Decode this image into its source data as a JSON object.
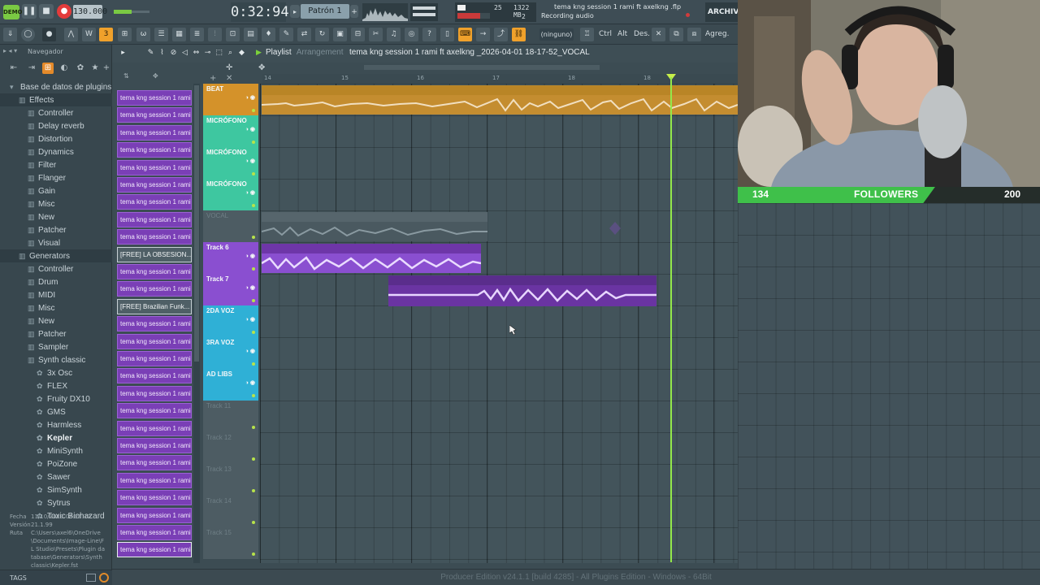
{
  "transport": {
    "logo_text": "DEMO",
    "bpm": "130.000",
    "time": "0:32:94",
    "pattern": "Patrón 1",
    "cpu_value": "25",
    "ram_value": "1322 MB",
    "poly_value": "2"
  },
  "hint_bar": {
    "file": "tema kng session 1 rami ft axelkng .flp",
    "status": "Recording audio"
  },
  "menu_label": "ARCHIVO (",
  "toolbar": {
    "ninguno": "(ninguno)",
    "ctrl": "Ctrl",
    "alt": "Alt",
    "des": "Des.",
    "agreg": "Agreg."
  },
  "browser": {
    "nav_title": "Navegador",
    "items": [
      {
        "label": "Base de datos de plugins",
        "indent": 0,
        "bold": false
      },
      {
        "label": "Effects",
        "indent": 1,
        "bold": false
      },
      {
        "label": "Controller",
        "indent": 2,
        "bold": false
      },
      {
        "label": "Delay reverb",
        "indent": 2,
        "bold": false
      },
      {
        "label": "Distortion",
        "indent": 2,
        "bold": false
      },
      {
        "label": "Dynamics",
        "indent": 2,
        "bold": false
      },
      {
        "label": "Filter",
        "indent": 2,
        "bold": false
      },
      {
        "label": "Flanger",
        "indent": 2,
        "bold": false
      },
      {
        "label": "Gain",
        "indent": 2,
        "bold": false
      },
      {
        "label": "Misc",
        "indent": 2,
        "bold": false
      },
      {
        "label": "New",
        "indent": 2,
        "bold": false
      },
      {
        "label": "Patcher",
        "indent": 2,
        "bold": false
      },
      {
        "label": "Visual",
        "indent": 2,
        "bold": false
      },
      {
        "label": "Generators",
        "indent": 1,
        "bold": false
      },
      {
        "label": "Controller",
        "indent": 2,
        "bold": false
      },
      {
        "label": "Drum",
        "indent": 2,
        "bold": false
      },
      {
        "label": "MIDI",
        "indent": 2,
        "bold": false
      },
      {
        "label": "Misc",
        "indent": 2,
        "bold": false
      },
      {
        "label": "New",
        "indent": 2,
        "bold": false
      },
      {
        "label": "Patcher",
        "indent": 2,
        "bold": false
      },
      {
        "label": "Sampler",
        "indent": 2,
        "bold": false
      },
      {
        "label": "Synth classic",
        "indent": 2,
        "bold": false
      },
      {
        "label": "3x Osc",
        "indent": 3,
        "bold": false
      },
      {
        "label": "FLEX",
        "indent": 3,
        "bold": false
      },
      {
        "label": "Fruity DX10",
        "indent": 3,
        "bold": false
      },
      {
        "label": "GMS",
        "indent": 3,
        "bold": false
      },
      {
        "label": "Harmless",
        "indent": 3,
        "bold": false
      },
      {
        "label": "Kepler",
        "indent": 3,
        "bold": true
      },
      {
        "label": "MiniSynth",
        "indent": 3,
        "bold": false
      },
      {
        "label": "PoiZone",
        "indent": 3,
        "bold": false
      },
      {
        "label": "Sawer",
        "indent": 3,
        "bold": false
      },
      {
        "label": "SimSynth",
        "indent": 3,
        "bold": false
      },
      {
        "label": "Sytrus",
        "indent": 3,
        "bold": false
      },
      {
        "label": "Toxic Biohazard",
        "indent": 3,
        "bold": false
      }
    ],
    "meta": {
      "fecha_label": "Fecha",
      "fecha": "11/10/2023 08:21:12",
      "version_label": "Versión",
      "version": "21.1.99",
      "ruta_label": "Ruta",
      "ruta": "C:\\Users\\axel6\\OneDrive\\Documents\\Image-Line\\FL Studio\\Presets\\Plugin database\\Generators\\Synth classic\\Kepler.fst"
    },
    "tags": "TAGS"
  },
  "playlist": {
    "title": "Playlist",
    "subtitle": "Arrangement",
    "file": "tema kng session 1 rami ft axelkng _2026-04-01 18-17-52_VOCAL",
    "ruler": [
      "14",
      "15",
      "16",
      "17",
      "18",
      "18"
    ],
    "patterns": [
      "tema kng session 1 rami...",
      "tema kng session 1 rami...",
      "tema kng session 1 rami...",
      "tema kng session 1 rami...",
      "tema kng session 1 rami...",
      "tema kng session 1 rami...",
      "tema kng session 1 rami...",
      "tema kng session 1 rami...",
      "tema kng session 1 rami...",
      "[FREE] LA OBSESION...",
      "tema kng session 1 rami...",
      "tema kng session 1 rami...",
      "[FREE] Brazilian Funk...",
      "tema kng session 1 rami...",
      "tema kng session 1 rami...",
      "tema kng session 1 rami...",
      "tema kng session 1 rami...",
      "tema kng session 1 rami...",
      "tema kng session 1 rami...",
      "tema kng session 1 rami...",
      "tema kng session 1 rami...",
      "tema kng session 1 rami...",
      "tema kng session 1 rami...",
      "tema kng session 1 rami...",
      "tema kng session 1 rami...",
      "tema kng session 1 rami...",
      "tema kng session 1 rami..."
    ],
    "tracks": [
      {
        "name": "BEAT",
        "color": "#d4922a"
      },
      {
        "name": "MICRÓFONO",
        "color": "#3ec7a0"
      },
      {
        "name": "MICRÓFONO",
        "color": "#3ec7a0"
      },
      {
        "name": "MICRÓFONO",
        "color": "#3ec7a0"
      },
      {
        "name": "VOCAL",
        "color": "#4d5c63"
      },
      {
        "name": "Track 6",
        "color": "#8a4fd0"
      },
      {
        "name": "Track 7",
        "color": "#8a4fd0"
      },
      {
        "name": "2DA VOZ",
        "color": "#2fb0d6"
      },
      {
        "name": "3RA VOZ",
        "color": "#2fb0d6"
      },
      {
        "name": "AD LIBS",
        "color": "#2fb0d6"
      },
      {
        "name": "Track 11",
        "color": "#4d5c63"
      },
      {
        "name": "Track 12",
        "color": "#4d5c63"
      },
      {
        "name": "Track 13",
        "color": "#4d5c63"
      },
      {
        "name": "Track 14",
        "color": "#4d5c63"
      },
      {
        "name": "Track 15",
        "color": "#4d5c63"
      }
    ],
    "clips": {
      "beat": "[FREE] Brazilian Funk x Club Banger Type Beat 2025 - Ritmo Agressivo",
      "vocal_ghost": "tema kng session 1 rami ft axelkng _2026-04-01 18-06-49_VOCAL",
      "track6": "tema kng session 1 rami ft axelkng _2026-04-01 18-09-32_VOCAL",
      "track7": "tema kng session 1 rami ft axelkng _2026-04-01 18-17-52_VOCAL"
    }
  },
  "followers": {
    "current": "134",
    "label": "FOLLOWERS",
    "goal": "200",
    "progress": 0.67
  },
  "status_bar": "Producer Edition v24.1.1 [build 4285] - All Plugins Edition - Windows - 64Bit",
  "colors": {
    "beat": "#d4922a",
    "microfono": "#3ec7a0",
    "pattern": "#7a3fb6",
    "voz": "#2fb0d6",
    "playhead": "#93e84a",
    "followers": "#3fc04a"
  }
}
